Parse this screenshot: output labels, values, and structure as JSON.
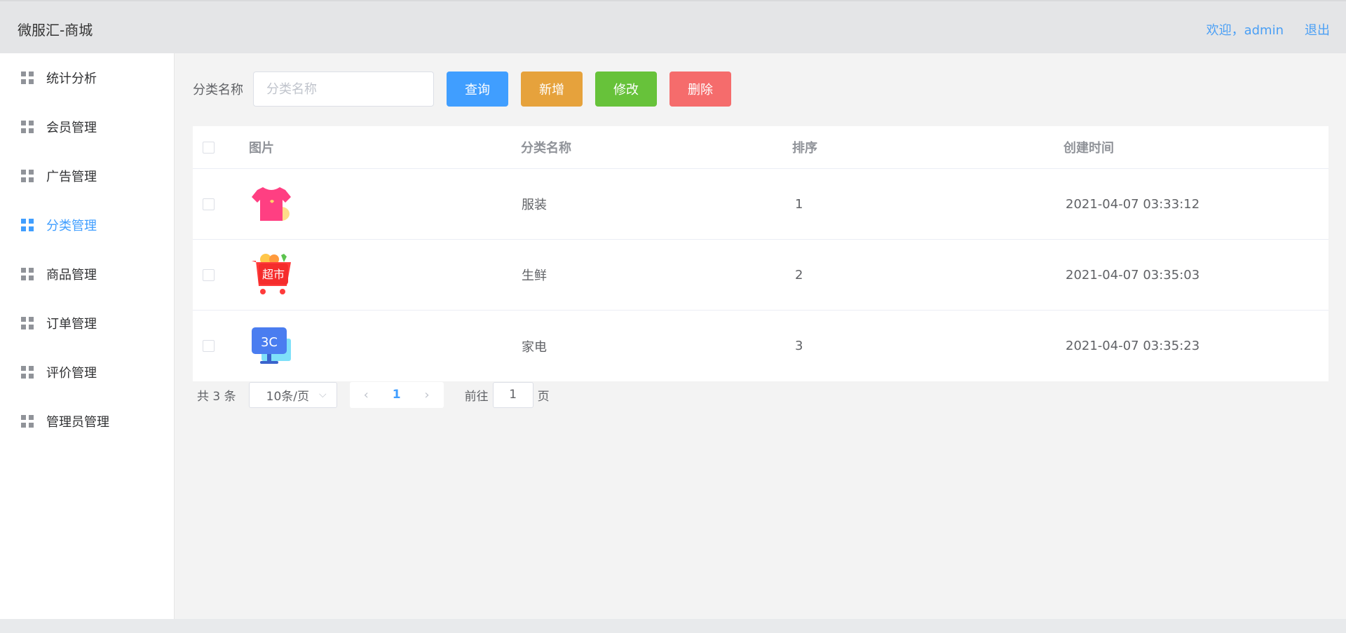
{
  "header": {
    "brand": "微服汇-商城",
    "welcome": "欢迎，admin",
    "logout": "退出"
  },
  "sidebar": {
    "items": [
      {
        "label": "统计分析",
        "active": false
      },
      {
        "label": "会员管理",
        "active": false
      },
      {
        "label": "广告管理",
        "active": false
      },
      {
        "label": "分类管理",
        "active": true
      },
      {
        "label": "商品管理",
        "active": false
      },
      {
        "label": "订单管理",
        "active": false
      },
      {
        "label": "评价管理",
        "active": false
      },
      {
        "label": "管理员管理",
        "active": false
      }
    ]
  },
  "toolbar": {
    "search_label": "分类名称",
    "search_placeholder": "分类名称",
    "search_value": "",
    "query_label": "查询",
    "add_label": "新增",
    "edit_label": "修改",
    "delete_label": "删除"
  },
  "table": {
    "columns": [
      "图片",
      "分类名称",
      "排序",
      "创建时间"
    ],
    "rows": [
      {
        "icon": "tshirt-icon",
        "name": "服装",
        "sort": "1",
        "created": "2021-04-07 03:33:12"
      },
      {
        "icon": "supermarket-cart-icon",
        "icon_text": "超市",
        "name": "生鲜",
        "sort": "2",
        "created": "2021-04-07 03:35:03"
      },
      {
        "icon": "monitor-3c-icon",
        "icon_text": "3C",
        "name": "家电",
        "sort": "3",
        "created": "2021-04-07 03:35:23"
      }
    ]
  },
  "pagination": {
    "total": "共 3 条",
    "page_size": "10条/页",
    "current_page": "1",
    "goto_prefix": "前往",
    "goto_value": "1",
    "goto_suffix": "页"
  },
  "colors": {
    "primary": "#409eff",
    "warning": "#e6a23c",
    "success": "#67c23a",
    "danger": "#f56c6c"
  }
}
